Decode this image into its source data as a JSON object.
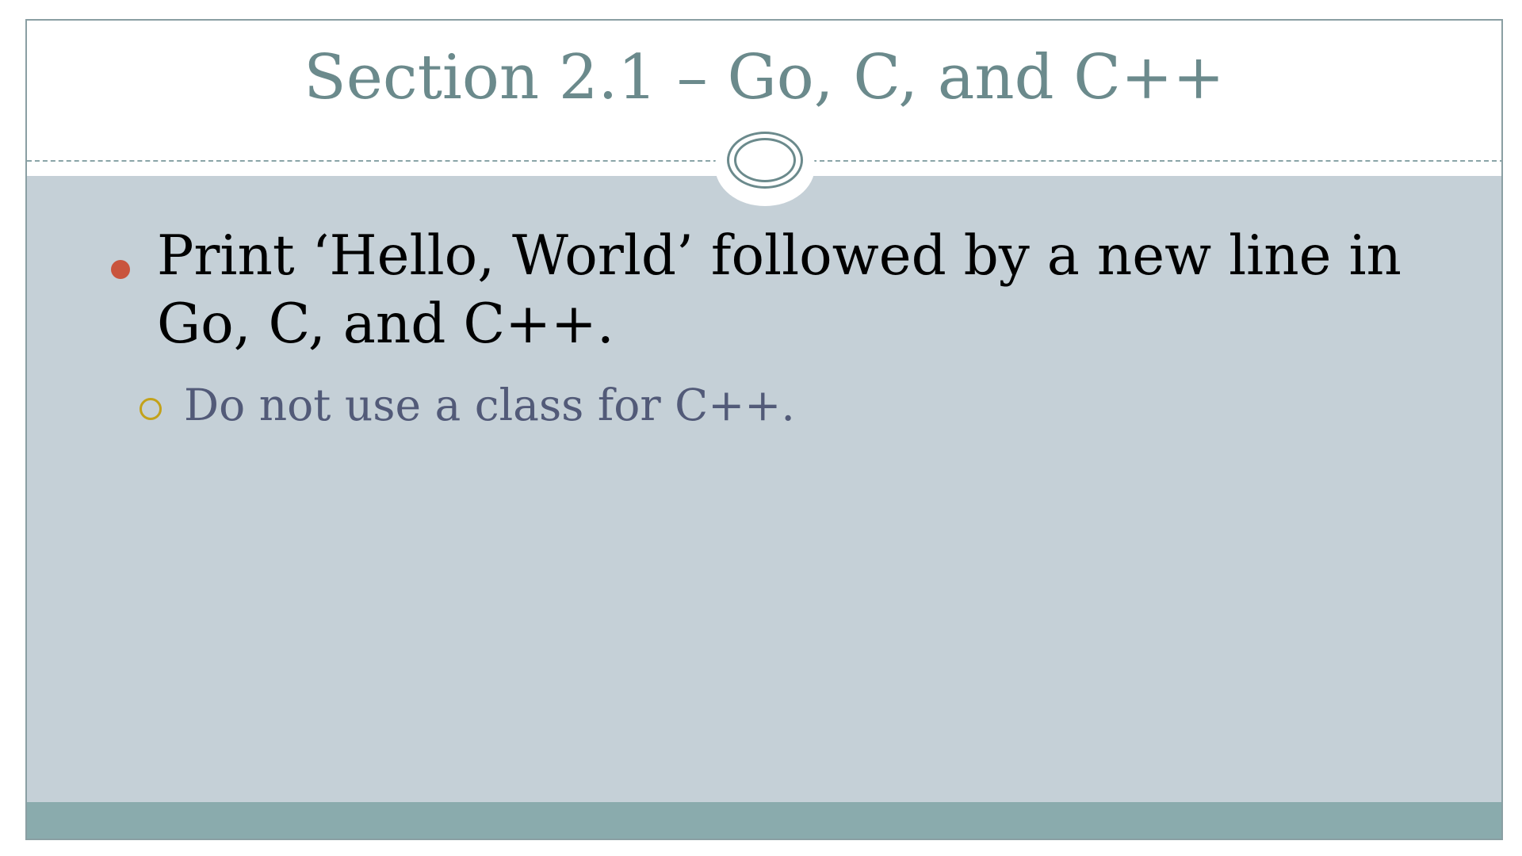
{
  "slide": {
    "title": "Section 2.1 – Go, C, and C++",
    "bullets": [
      {
        "text": "Print ‘Hello, World’ followed by a new line in Go, C, and C++."
      },
      {
        "text": "Do not use a class for C++."
      }
    ]
  },
  "colors": {
    "title": "#6b8a8c",
    "content_background": "#c5d0d7",
    "footer_bar": "#8aabad",
    "bullet_dot": "#c9543d",
    "sub_bullet_ring": "#c3a21a",
    "sub_bullet_text": "#525a78"
  },
  "icons": {
    "medallion": "double-ellipse-ornament",
    "bullet": "filled-circle",
    "sub_bullet": "hollow-circle"
  }
}
